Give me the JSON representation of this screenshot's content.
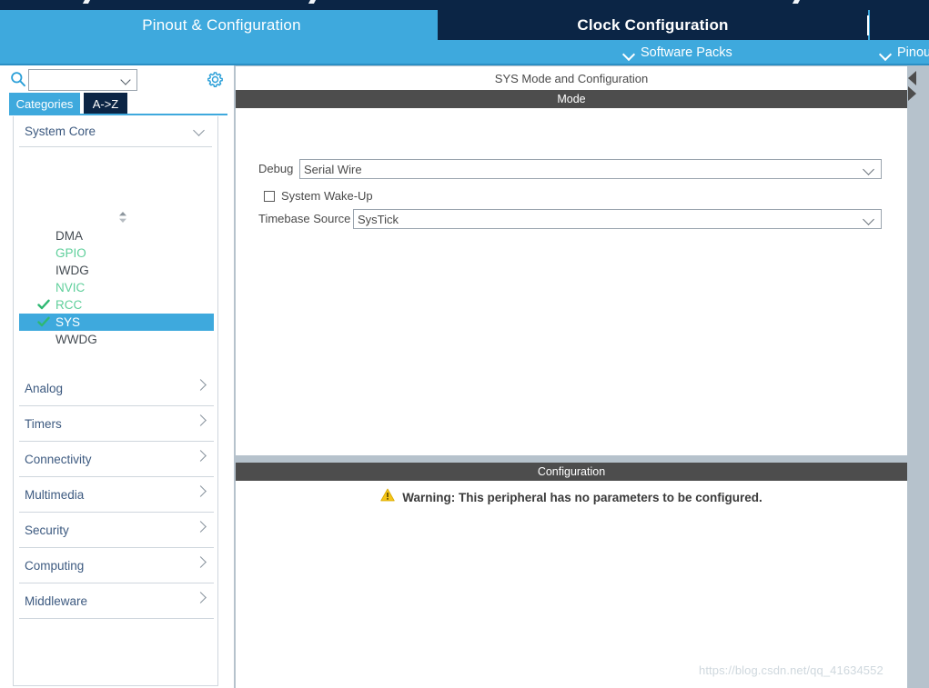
{
  "window": {
    "top_tabs": [
      {
        "label": "Pinout & Configuration",
        "active": false
      },
      {
        "label": "Clock Configuration",
        "active": true
      },
      {
        "label": "",
        "active": false
      }
    ],
    "sub_bar": [
      {
        "label": "Software Packs",
        "icon": "chevron-down-icon"
      },
      {
        "label": "Pinout",
        "icon": "chevron-down-icon"
      }
    ]
  },
  "sidebar": {
    "search": {
      "value": "",
      "placeholder": "",
      "icon": "search-icon"
    },
    "gear_icon": "gear-icon",
    "view_tabs": [
      {
        "label": "Categories",
        "active": true
      },
      {
        "label": "A->Z",
        "active": false
      }
    ],
    "open_group": {
      "label": "System Core",
      "chevron": "chevron-down-icon",
      "peripherals": [
        {
          "label": "DMA",
          "state": "none",
          "selected": false
        },
        {
          "label": "GPIO",
          "state": "partial",
          "selected": false
        },
        {
          "label": "IWDG",
          "state": "none",
          "selected": false
        },
        {
          "label": "NVIC",
          "state": "partial",
          "selected": false
        },
        {
          "label": "RCC",
          "state": "checked",
          "selected": false
        },
        {
          "label": "SYS",
          "state": "checked",
          "selected": true
        },
        {
          "label": "WWDG",
          "state": "none",
          "selected": false
        }
      ]
    },
    "groups": [
      {
        "label": "Analog",
        "chevron": "chevron-right-icon"
      },
      {
        "label": "Timers",
        "chevron": "chevron-right-icon"
      },
      {
        "label": "Connectivity",
        "chevron": "chevron-right-icon"
      },
      {
        "label": "Multimedia",
        "chevron": "chevron-right-icon"
      },
      {
        "label": "Security",
        "chevron": "chevron-right-icon"
      },
      {
        "label": "Computing",
        "chevron": "chevron-right-icon"
      },
      {
        "label": "Middleware",
        "chevron": "chevron-right-icon"
      }
    ]
  },
  "main": {
    "panel_title": "SYS Mode and Configuration",
    "mode_section_title": "Mode",
    "fields": [
      {
        "label": "Debug",
        "value": "Serial Wire",
        "type": "select"
      },
      {
        "label": "Timebase Source",
        "value": "SysTick",
        "type": "select"
      }
    ],
    "checkbox": {
      "label": "System Wake-Up",
      "checked": false
    },
    "config_section_title": "Configuration",
    "warning": {
      "icon": "warning-triangle-icon",
      "text": "Warning: This peripheral has no parameters to be configured."
    }
  },
  "watermark": "https://blog.csdn.net/qq_41634552",
  "colors": {
    "accent_blue": "#3ea9dd",
    "dark_navy": "#0b2545",
    "section_gray": "#4d4d4d",
    "workspace_gray": "#b6c2cc",
    "green_check": "#2eb872",
    "warning_yellow": "#f5c518",
    "group_text": "#3d5a80"
  }
}
